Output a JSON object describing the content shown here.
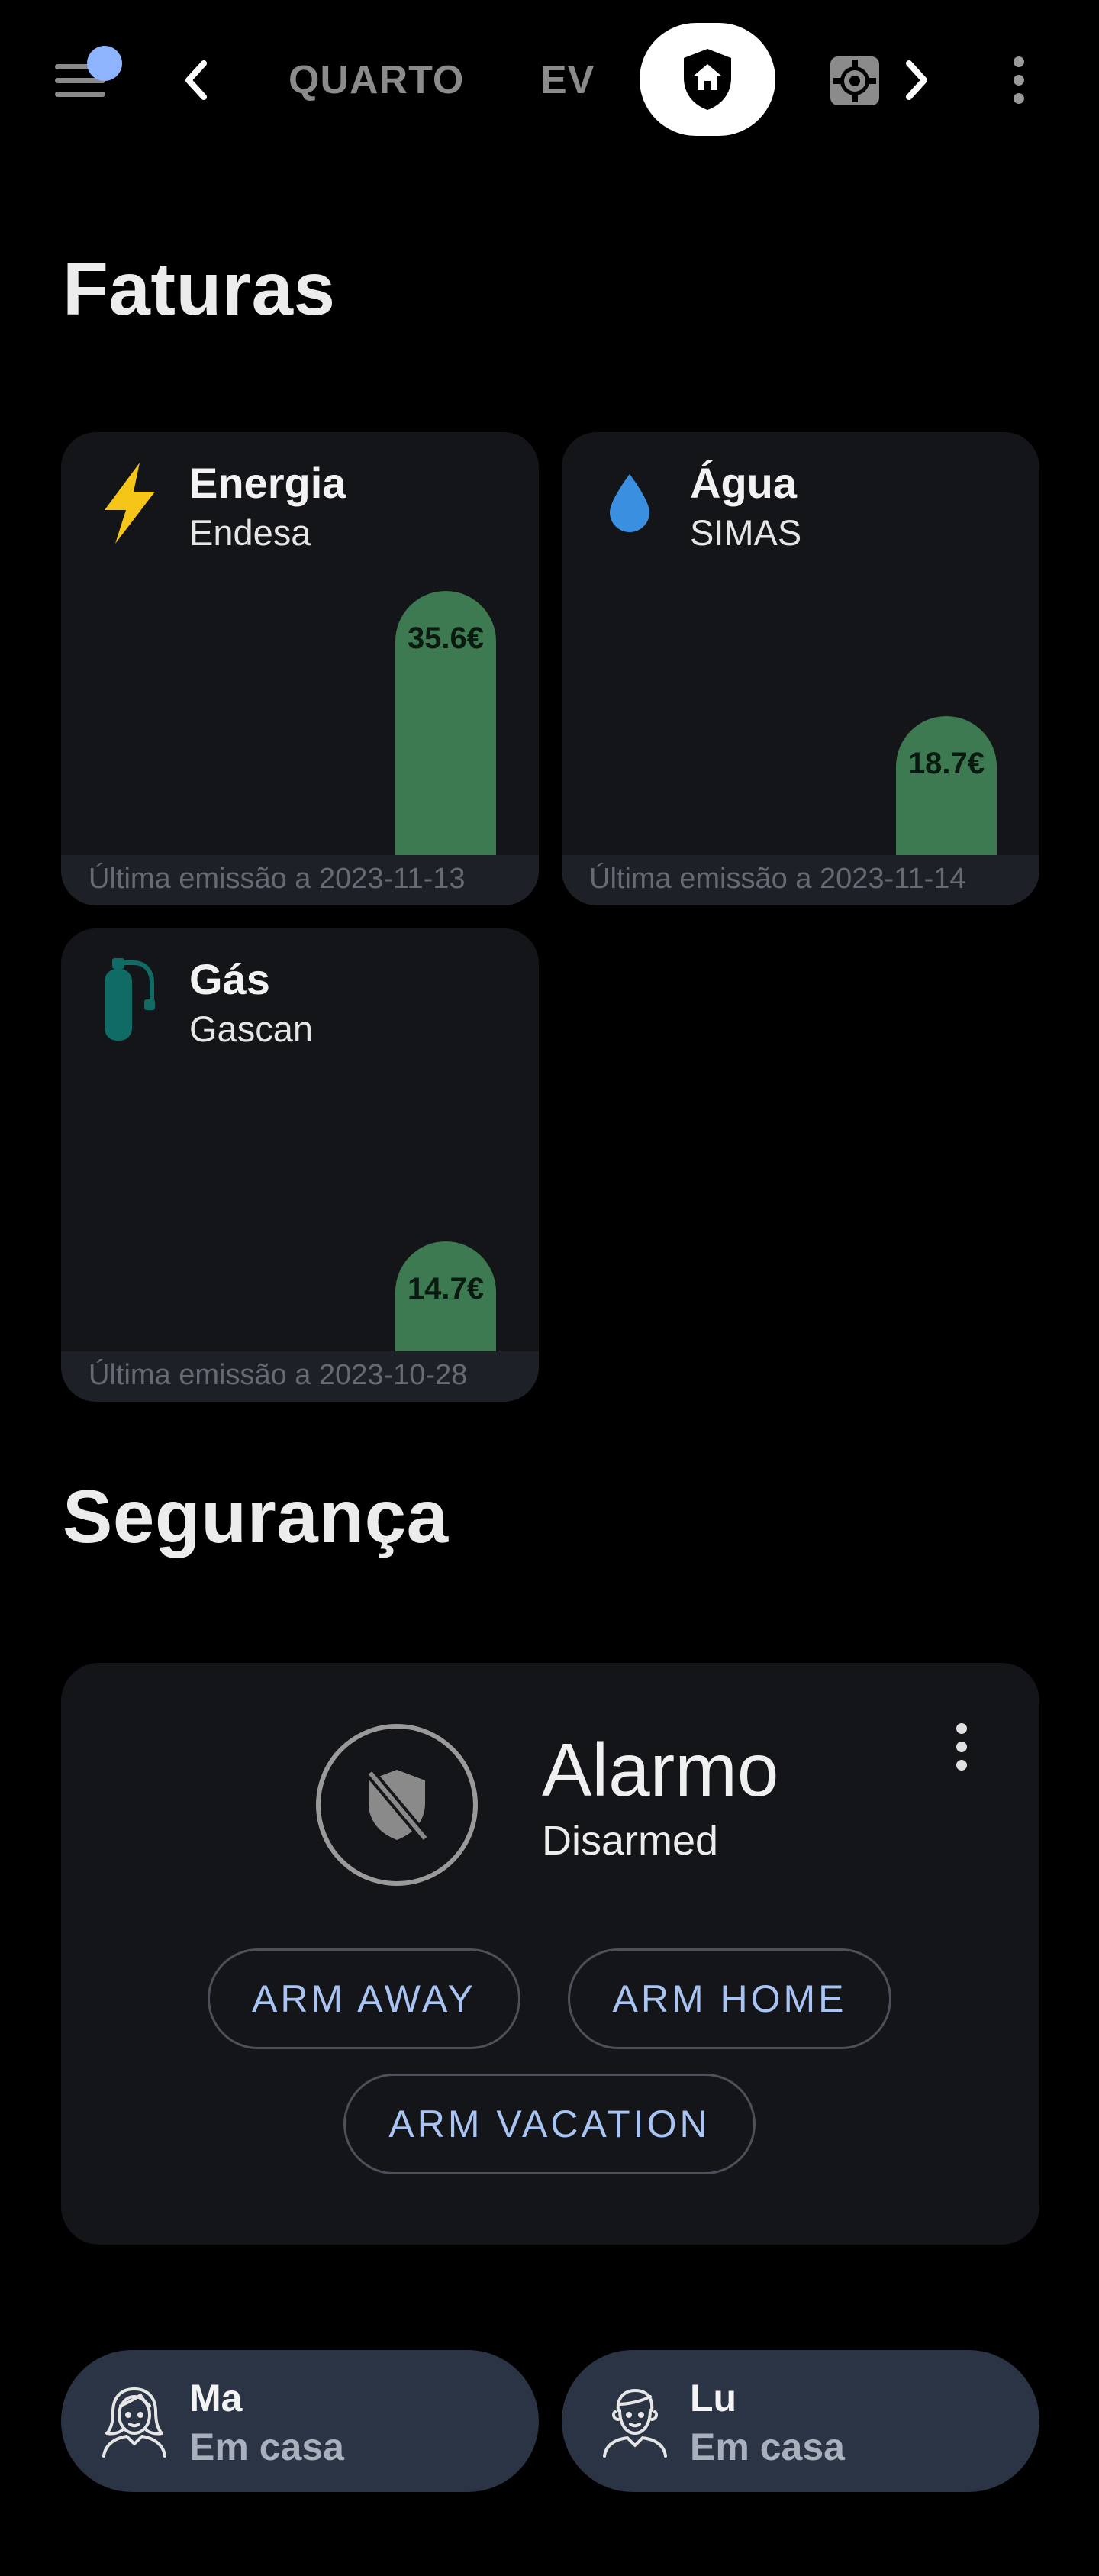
{
  "nav": {
    "tabs": [
      {
        "label": "QUARTO"
      },
      {
        "label": "EV"
      }
    ],
    "icons": {
      "menu": "menu-icon",
      "back": "chevron-left-icon",
      "forward": "chevron-right-icon",
      "home": "home-shield-icon",
      "settings": "gear-icon",
      "overflow": "more-vertical-icon"
    },
    "badge_color": "#8fb4ff"
  },
  "bills": {
    "title": "Faturas",
    "items": [
      {
        "name": "Energia",
        "provider": "Endesa",
        "value_label": "35.6€",
        "value": 35.6,
        "footer": "Última emissão a 2023-11-13",
        "icon": "lightning-icon",
        "icon_color": "#f5c518"
      },
      {
        "name": "Água",
        "provider": "SIMAS",
        "value_label": "18.7€",
        "value": 18.7,
        "footer": "Última emissão a 2023-11-14",
        "icon": "water-drop-icon",
        "icon_color": "#3b8fe0"
      },
      {
        "name": "Gás",
        "provider": "Gascan",
        "value_label": "14.7€",
        "value": 14.7,
        "footer": "Última emissão a 2023-10-28",
        "icon": "gas-cylinder-icon",
        "icon_color": "#0f6b63"
      }
    ],
    "bar_color": "#3e7a51"
  },
  "security": {
    "title": "Segurança",
    "alarm": {
      "name": "Alarmo",
      "state": "Disarmed",
      "icon": "shield-off-icon",
      "buttons": {
        "arm_away": "ARM AWAY",
        "arm_home": "ARM HOME",
        "arm_vacation": "ARM VACATION"
      }
    }
  },
  "people": [
    {
      "name": "Ma",
      "state": "Em casa",
      "icon": "woman-avatar-icon"
    },
    {
      "name": "Lu",
      "state": "Em casa",
      "icon": "man-avatar-icon"
    }
  ]
}
